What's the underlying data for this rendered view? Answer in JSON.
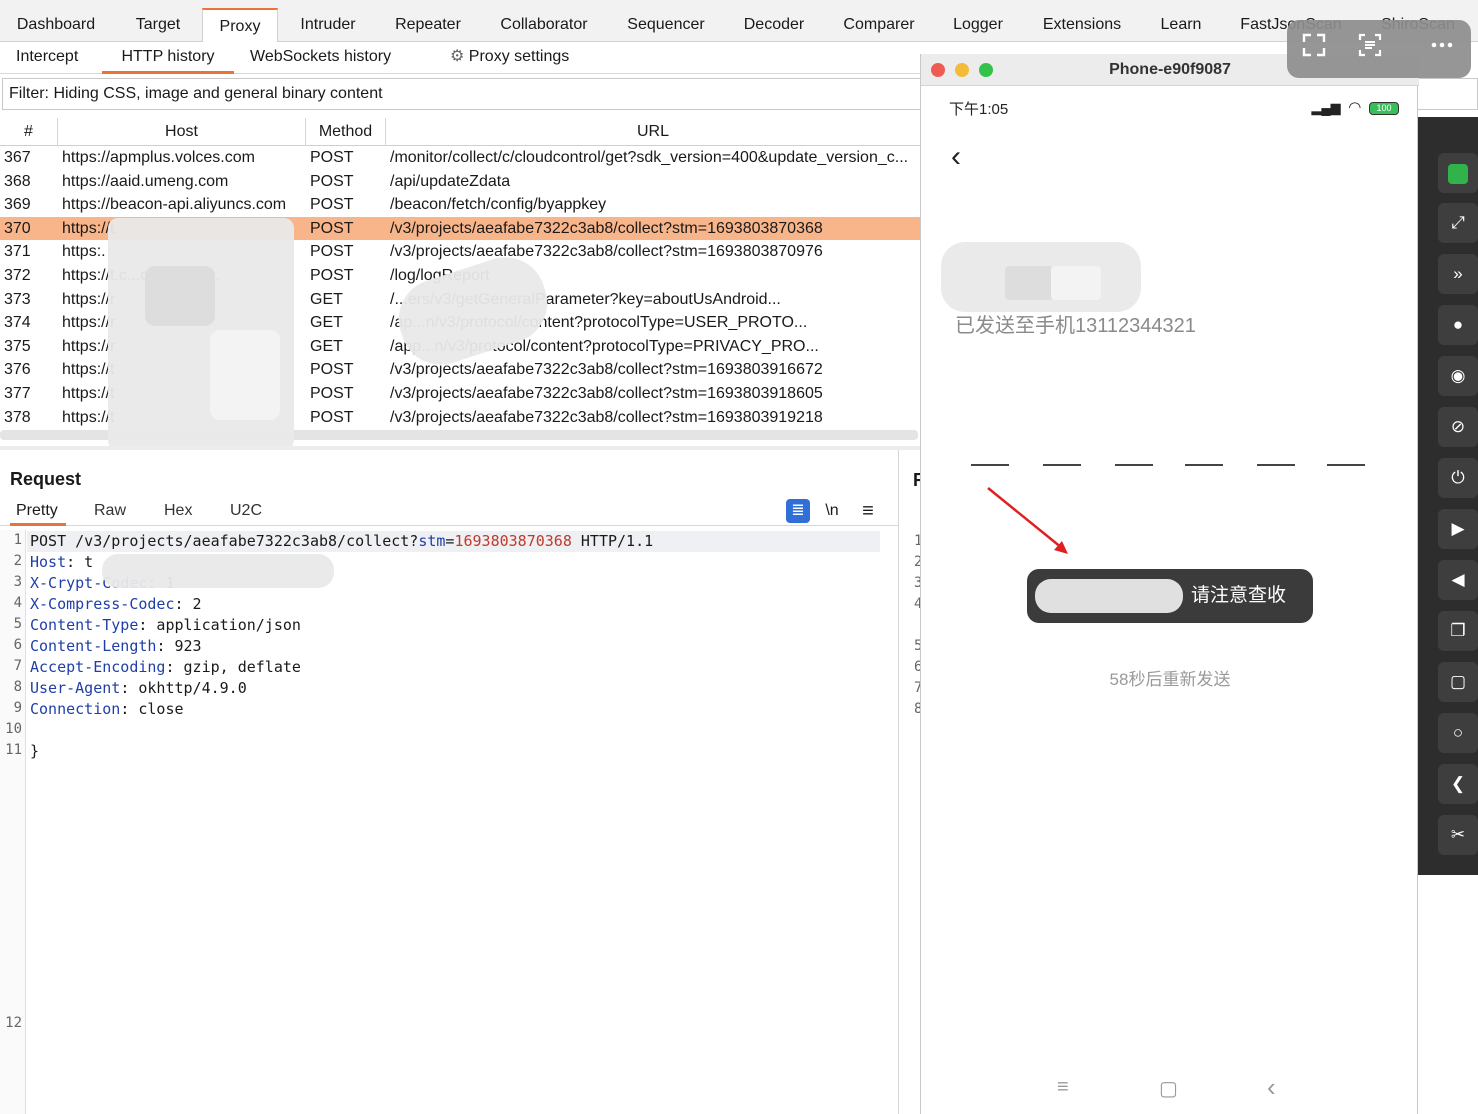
{
  "menu": {
    "tabs": [
      "Dashboard",
      "Target",
      "Proxy",
      "Intruder",
      "Repeater",
      "Collaborator",
      "Sequencer",
      "Decoder",
      "Comparer",
      "Logger",
      "Extensions",
      "Learn",
      "FastJsonScan",
      "ShiroScan"
    ],
    "active": "Proxy"
  },
  "proxy_tabs": {
    "intercept": "Intercept",
    "http_history": "HTTP history",
    "websockets": "WebSockets history",
    "settings": "Proxy settings"
  },
  "filter": "Filter: Hiding CSS, image and general binary content",
  "table": {
    "columns": [
      "#",
      "Host",
      "Method",
      "URL"
    ],
    "rows": [
      {
        "n": "367",
        "host": "https://apmplus.volces.com",
        "method": "POST",
        "url": "/monitor/collect/c/cloudcontrol/get?sdk_version=400&update_version_c..."
      },
      {
        "n": "368",
        "host": "https://aaid.umeng.com",
        "method": "POST",
        "url": "/api/updateZdata"
      },
      {
        "n": "369",
        "host": "https://beacon-api.aliyuncs.com",
        "method": "POST",
        "url": "/beacon/fetch/config/byappkey"
      },
      {
        "n": "370",
        "host": "https://t",
        "method": "POST",
        "url": "/v3/projects/aeafabe7322c3ab8/collect?stm=1693803870368"
      },
      {
        "n": "371",
        "host": "https:.",
        "method": "POST",
        "url": "/v3/projects/aeafabe7322c3ab8/collect?stm=1693803870976"
      },
      {
        "n": "372",
        "host": "https://t.c...ort.com:9...",
        "method": "POST",
        "url": "/log/logReport"
      },
      {
        "n": "373",
        "host": "https://r",
        "method": "GET",
        "url": "/...ers/v3/getGeneralParameter?key=aboutUsAndroid..."
      },
      {
        "n": "374",
        "host": "https://r",
        "method": "GET",
        "url": "/ap...n/v3/protocol/content?protocolType=USER_PROTO..."
      },
      {
        "n": "375",
        "host": "https://r",
        "method": "GET",
        "url": "/app...n/v3/protocol/content?protocolType=PRIVACY_PRO..."
      },
      {
        "n": "376",
        "host": "https://t",
        "method": "POST",
        "url": "/v3/projects/aeafabe7322c3ab8/collect?stm=1693803916672"
      },
      {
        "n": "377",
        "host": "https://t",
        "method": "POST",
        "url": "/v3/projects/aeafabe7322c3ab8/collect?stm=1693803918605"
      },
      {
        "n": "378",
        "host": "https://t",
        "method": "POST",
        "url": "/v3/projects/aeafabe7322c3ab8/collect?stm=1693803919218"
      }
    ],
    "selected_index": 3
  },
  "request": {
    "title": "Request",
    "tabs": [
      "Pretty",
      "Raw",
      "Hex",
      "U2C"
    ],
    "active_tab": "Pretty",
    "icons": {
      "wrap": "≣",
      "newline": "\\n",
      "menu": "≡"
    },
    "line1": {
      "method_path": "POST /v3/projects/aeafabe7322c3ab8/collect?",
      "param": "stm",
      "eq": "=",
      "value": "1693803870368",
      "proto": " HTTP/1.1"
    },
    "headers": [
      {
        "k": "Host",
        "v": " t"
      },
      {
        "k": "X-Crypt-Codec",
        "v": " 1"
      },
      {
        "k": "X-Compress-Codec",
        "v": " 2"
      },
      {
        "k": "Content-Type",
        "v": " application/json"
      },
      {
        "k": "Content-Length",
        "v": " 923"
      },
      {
        "k": "Accept-Encoding",
        "v": " gzip, deflate"
      },
      {
        "k": "User-Agent",
        "v": " okhttp/4.9.0"
      },
      {
        "k": "Connection",
        "v": " close"
      }
    ],
    "line11": "}"
  },
  "response_strip": {
    "title": "R",
    "nums": [
      "1",
      "2",
      "3",
      "4",
      "5",
      "6",
      "7",
      "8"
    ]
  },
  "phone": {
    "title": "Phone-e90f9087",
    "time": "下午1:05",
    "signal": "▂▄▆",
    "wifi": "◠",
    "battery": "100",
    "back": "‹",
    "sent_text": "已发送至手机13112344321",
    "toast": "请注意查收",
    "resend": "58秒后重新发送",
    "nav": {
      "menu": "≡",
      "home": "▢",
      "back": "‹"
    }
  },
  "overlay_icons": [
    "expand-icon",
    "text-scan-icon",
    "more-icon"
  ],
  "sidebar_icons": [
    "app-icon",
    "fullscreen-icon",
    "collapse-icon",
    "record-icon",
    "eye-icon",
    "eye-off-icon",
    "power-icon",
    "volume-up-icon",
    "volume-down-icon",
    "copy-icon",
    "square-icon",
    "circle-icon",
    "back-icon",
    "scissors-icon"
  ],
  "colors": {
    "accent": "#e8743b",
    "selected_row": "#f9b58a",
    "header_key": "#1f3fa8",
    "param_value": "#c0392b",
    "wrap_button": "#2f6fd6"
  }
}
